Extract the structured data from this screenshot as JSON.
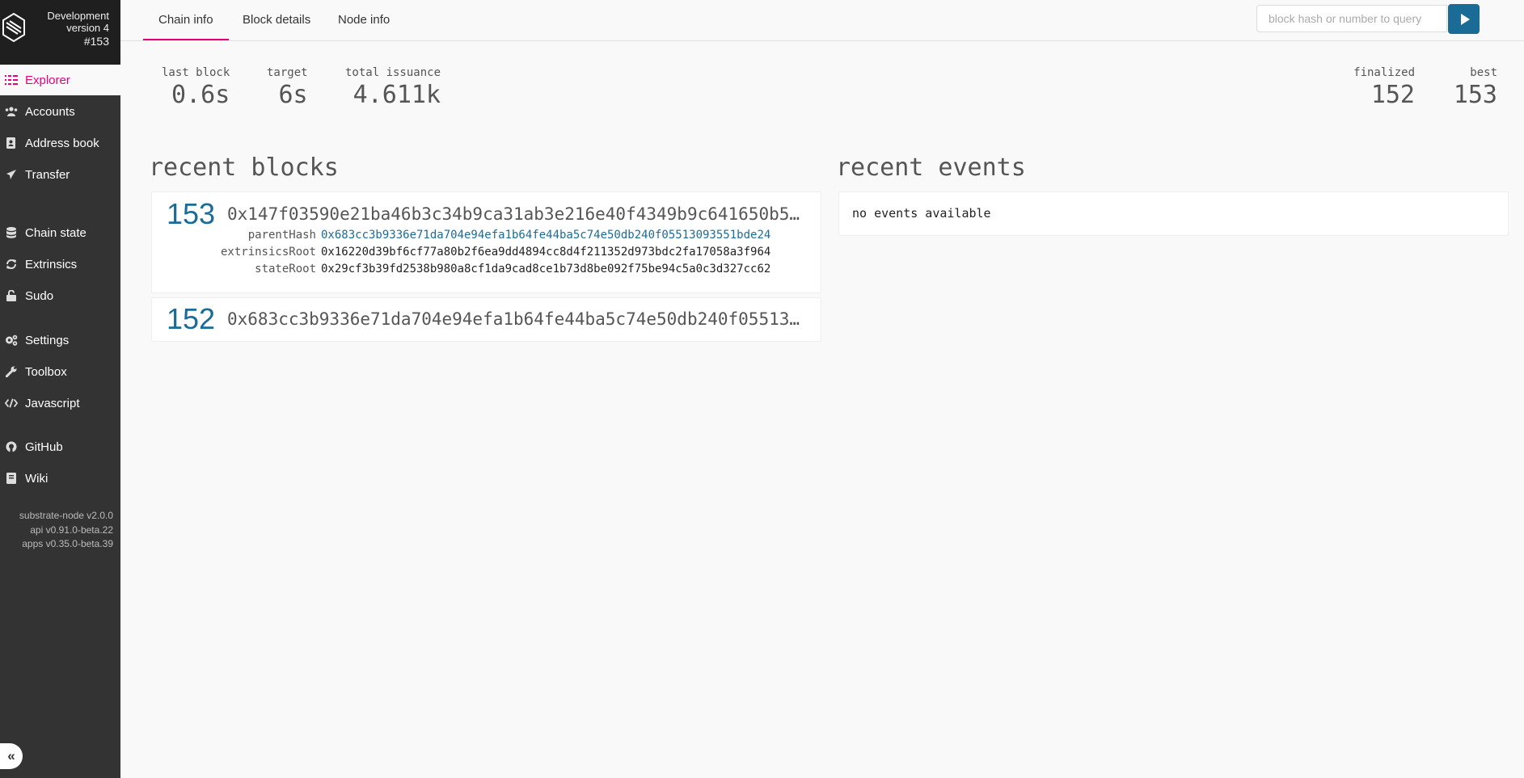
{
  "chain": {
    "name": "Development",
    "version": "version 4",
    "block": "#153"
  },
  "sidebar": {
    "items": [
      {
        "label": "Explorer",
        "icon": "explorer-icon"
      },
      {
        "label": "Accounts",
        "icon": "users-icon"
      },
      {
        "label": "Address book",
        "icon": "address-book-icon"
      },
      {
        "label": "Transfer",
        "icon": "paper-plane-icon"
      },
      {
        "label": "Chain state",
        "icon": "database-icon"
      },
      {
        "label": "Extrinsics",
        "icon": "sync-icon"
      },
      {
        "label": "Sudo",
        "icon": "unlock-icon"
      },
      {
        "label": "Settings",
        "icon": "gears-icon"
      },
      {
        "label": "Toolbox",
        "icon": "wrench-icon"
      },
      {
        "label": "Javascript",
        "icon": "code-icon"
      },
      {
        "label": "GitHub",
        "icon": "github-icon"
      },
      {
        "label": "Wiki",
        "icon": "book-icon"
      }
    ],
    "versions": [
      "substrate-node v2.0.0",
      "api v0.91.0-beta.22",
      "apps v0.35.0-beta.39"
    ],
    "collapse_label": "«"
  },
  "tabs": [
    "Chain info",
    "Block details",
    "Node info"
  ],
  "search": {
    "placeholder": "block hash or number to query"
  },
  "summary": {
    "last_block": {
      "label": "last block",
      "value": "0.6s"
    },
    "target": {
      "label": "target",
      "value": "6s"
    },
    "total_issuance": {
      "label": "total issuance",
      "value": "4.611k"
    },
    "finalized": {
      "label": "finalized",
      "value": "152"
    },
    "best": {
      "label": "best",
      "value": "153"
    }
  },
  "recent_blocks": {
    "title": "recent blocks",
    "blocks": [
      {
        "number": "153",
        "hash": "0x147f03590e21ba46b3c34b9ca31ab3e216e40f4349b9c641650b5...",
        "details": [
          {
            "label": "parentHash",
            "value": "0x683cc3b9336e71da704e94efa1b64fe44ba5c74e50db240f05513093551bde24"
          },
          {
            "label": "extrinsicsRoot",
            "value": "0x16220d39bf6cf77a80b2f6ea9dd4894cc8d4f211352d973bdc2fa17058a3f964"
          },
          {
            "label": "stateRoot",
            "value": "0x29cf3b39fd2538b980a8cf1da9cad8ce1b73d8be092f75be94c5a0c3d327cc62"
          }
        ]
      },
      {
        "number": "152",
        "hash": "0x683cc3b9336e71da704e94efa1b64fe44ba5c74e50db240f05513..."
      }
    ]
  },
  "recent_events": {
    "title": "recent events",
    "empty_text": "no events available"
  },
  "colors": {
    "accent": "#e6007a",
    "link": "#1a6c97",
    "sidebar": "#333333"
  }
}
